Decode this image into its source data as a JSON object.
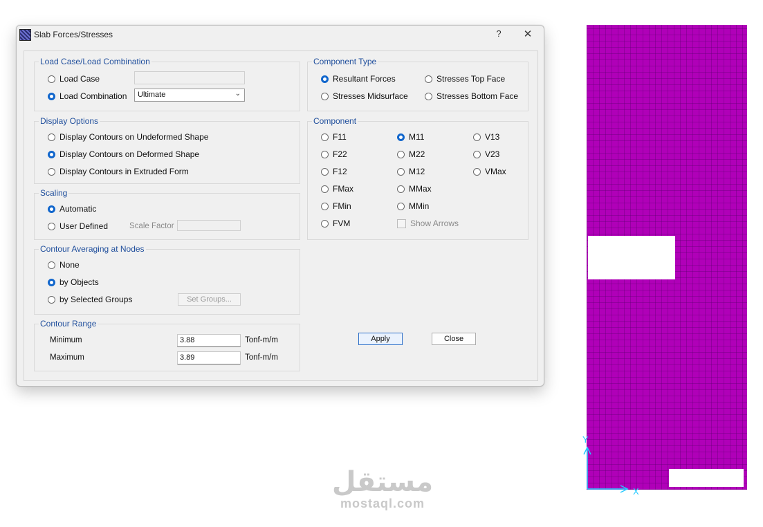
{
  "window": {
    "title": "Slab Forces/Stresses",
    "help": "?",
    "close": "✕"
  },
  "load_case": {
    "legend": "Load Case/Load Combination",
    "load_case_label": "Load Case",
    "load_case_value": "",
    "load_combination_label": "Load Combination",
    "load_combination_value": "Ultimate",
    "selected": "load_combination"
  },
  "display_options": {
    "legend": "Display Options",
    "items": [
      "Display Contours on Undeformed Shape",
      "Display Contours on Deformed Shape",
      "Display Contours in Extruded Form"
    ],
    "selected_index": 1
  },
  "scaling": {
    "legend": "Scaling",
    "automatic": "Automatic",
    "user_defined": "User Defined",
    "scale_factor_label": "Scale Factor",
    "scale_factor_value": "",
    "selected": "automatic"
  },
  "averaging": {
    "legend": "Contour Averaging at Nodes",
    "items": [
      "None",
      "by Objects",
      "by Selected Groups"
    ],
    "selected_index": 1,
    "set_groups_button": "Set Groups..."
  },
  "contour_range": {
    "legend": "Contour Range",
    "minimum_label": "Minimum",
    "minimum_value": "3.88",
    "maximum_label": "Maximum",
    "maximum_value": "3.89",
    "unit": "Tonf-m/m"
  },
  "component_type": {
    "legend": "Component Type",
    "items": [
      "Resultant Forces",
      "Stresses Top Face",
      "Stresses Midsurface",
      "Stresses Bottom Face"
    ],
    "selected_index": 0
  },
  "component": {
    "legend": "Component",
    "col1": [
      "F11",
      "F22",
      "F12",
      "FMax",
      "FMin",
      "FVM"
    ],
    "col2": [
      "M11",
      "M22",
      "M12",
      "MMax",
      "MMin"
    ],
    "col3": [
      "V13",
      "V23",
      "VMax"
    ],
    "selected": "M11",
    "show_arrows_label": "Show Arrows",
    "show_arrows_checked": false
  },
  "buttons": {
    "apply": "Apply",
    "close": "Close"
  },
  "model_view": {
    "axis_y": "Y",
    "axis_x": "X",
    "fill_color": "#b000b8"
  },
  "watermark": {
    "arabic": "مستقل",
    "latin": "mostaql.com"
  }
}
